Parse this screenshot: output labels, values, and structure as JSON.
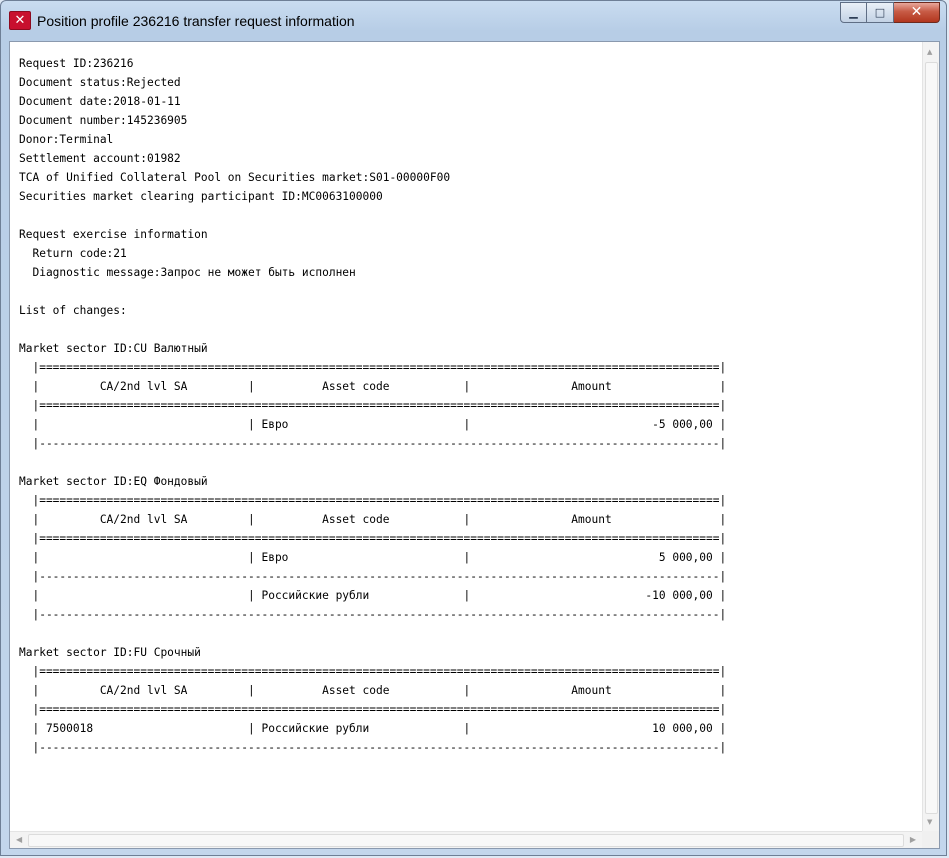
{
  "window": {
    "title": "Position profile 236216 transfer request information",
    "controls": {
      "minimize": "▁",
      "maximize": "□",
      "close": "✕"
    }
  },
  "icons": {
    "app": "moex-logo-icon",
    "scroll_up": "▲",
    "scroll_down": "▼",
    "scroll_left": "◀",
    "scroll_right": "▶"
  },
  "colors": {
    "app_icon": "#c8102e",
    "close_button": "#c75b45",
    "title_bar": "#b7cde6"
  },
  "request": {
    "id": "Request ID:236216",
    "status": "Document status:Rejected",
    "date": "Document date:2018-01-11",
    "number": "Document number:145236905",
    "donor": "Donor:Terminal",
    "settlement": "Settlement account:01982",
    "tca": "TCA of Unified Collateral Pool on Securities market:S01-00000F00",
    "participant": "Securities market clearing participant ID:MC0063100000"
  },
  "exercise": {
    "heading": "Request exercise information",
    "return_code": "  Return code:21",
    "diagnostic": "  Diagnostic message:Запрос не может быть исполнен"
  },
  "changes_heading": "List of changes:",
  "table_columns": [
    "CA/2nd lvl SA",
    "Asset code",
    "Amount"
  ],
  "sectors": [
    {
      "title": "Market sector ID:CU Валютный",
      "rows": [
        {
          "account": "",
          "asset": "Евро",
          "amount": "-5 000,00"
        }
      ]
    },
    {
      "title": "Market sector ID:EQ Фондовый",
      "rows": [
        {
          "account": "",
          "asset": "Евро",
          "amount": "5 000,00"
        },
        {
          "account": "",
          "asset": "Российские рубли",
          "amount": "-10 000,00"
        }
      ]
    },
    {
      "title": "Market sector ID:FU Срочный",
      "rows": [
        {
          "account": "7500018",
          "asset": "Российские рубли",
          "amount": "10 000,00"
        }
      ]
    }
  ]
}
